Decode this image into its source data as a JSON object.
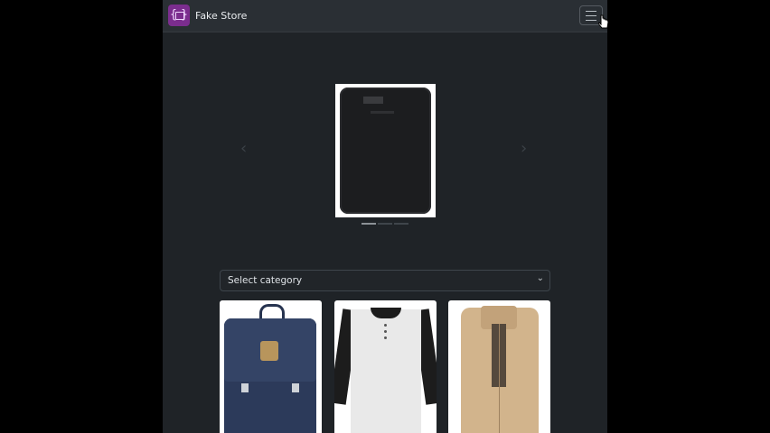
{
  "navbar": {
    "brand": "Fake Store",
    "logo_icon": "shopping-bag-braces-icon",
    "toggler_icon": "hamburger-menu-icon"
  },
  "carousel": {
    "prev_icon": "chevron-left-icon",
    "next_icon": "chevron-right-icon",
    "prev_glyph": "‹",
    "next_glyph": "›",
    "slide_count": 3,
    "active_index": 0
  },
  "filter": {
    "select_value": "Select category",
    "chevron_glyph": "⌄"
  },
  "products": [
    {
      "image": "backpack"
    },
    {
      "image": "raglan-t-shirt"
    },
    {
      "image": "khaki-jacket"
    }
  ],
  "colors": {
    "navbar_bg": "#2a2f34",
    "page_bg": "#1f2327",
    "brand_purple": "#7b2d8e"
  }
}
